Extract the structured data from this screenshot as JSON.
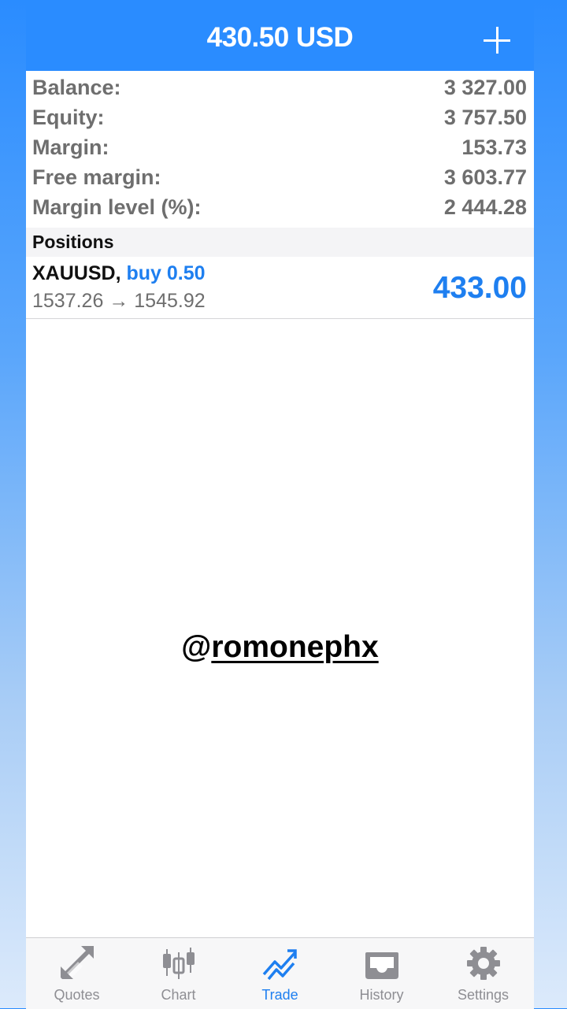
{
  "header": {
    "title": "430.50 USD",
    "add_icon": "plus-icon"
  },
  "summary": [
    {
      "label": "Balance:",
      "value": "3 327.00"
    },
    {
      "label": "Equity:",
      "value": "3 757.50"
    },
    {
      "label": "Margin:",
      "value": "153.73"
    },
    {
      "label": "Free margin:",
      "value": "3 603.77"
    },
    {
      "label": "Margin level (%):",
      "value": "2 444.28"
    }
  ],
  "positions": {
    "heading": "Positions",
    "items": [
      {
        "symbol": "XAUUSD,",
        "side": "buy 0.50",
        "prices": "1537.26 → 1545.92",
        "profit": "433.00"
      }
    ]
  },
  "watermark": {
    "at": "@",
    "handle": "romonephx"
  },
  "tabbar": {
    "active": "Trade",
    "tabs": [
      {
        "label": "Quotes",
        "icon": "quotes-icon"
      },
      {
        "label": "Chart",
        "icon": "candlestick-chart-icon"
      },
      {
        "label": "Trade",
        "icon": "trade-trend-icon"
      },
      {
        "label": "History",
        "icon": "inbox-tray-icon"
      },
      {
        "label": "Settings",
        "icon": "gear-icon"
      }
    ]
  },
  "colors": {
    "accent": "#2a8cff",
    "active_blue": "#1e7ff0",
    "label_gray": "#6e6e6e",
    "tab_gray": "#8e8e93"
  }
}
